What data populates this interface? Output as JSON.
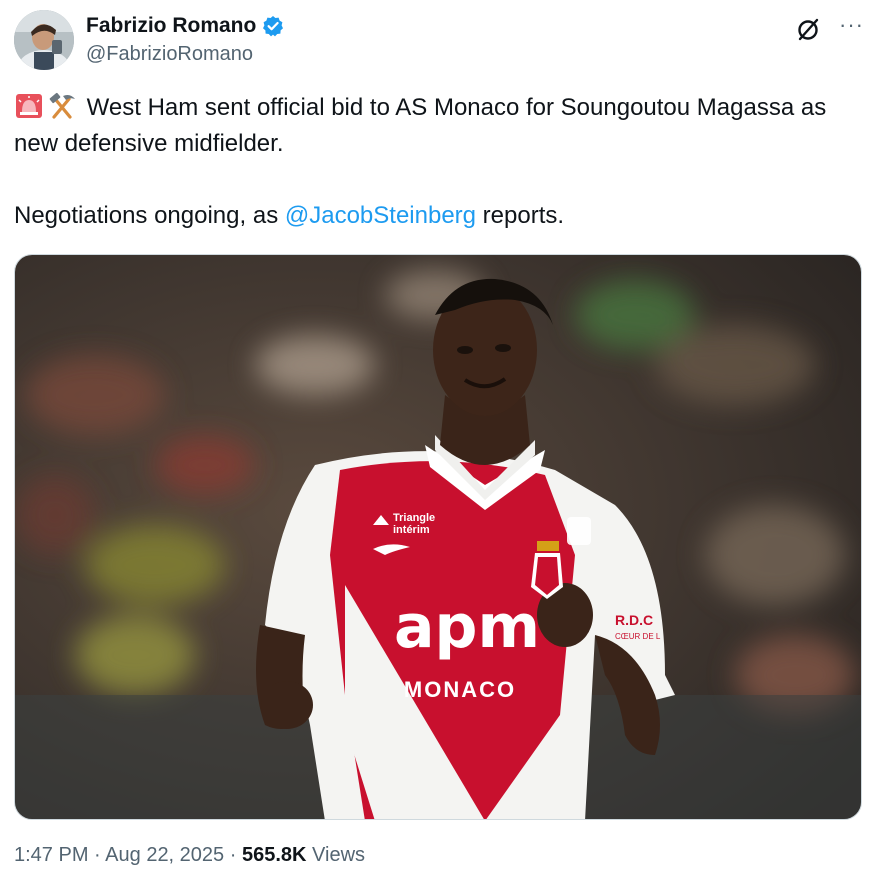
{
  "author": {
    "display_name": "Fabrizio Romano",
    "handle": "@FabrizioRomano",
    "verified": true
  },
  "icons": {
    "verified": "verified-badge-icon",
    "grok": "grok-icon",
    "more": "more-icon",
    "siren": "siren-emoji",
    "hammer_pick": "hammer-and-pick-emoji"
  },
  "tweet": {
    "line1": "West Ham sent official bid to AS Monaco for Soungoutou Magassa as new defensive midfielder.",
    "line2_before": "Negotiations ongoing, as ",
    "line2_mention": "@JacobSteinberg",
    "line2_after": " reports."
  },
  "image": {
    "shirt_sponsor": "apm",
    "shirt_city": "MONACO",
    "sleeve_sponsor": "Triangle intérim",
    "sleeve_badge": "R.D.C.",
    "sleeve_badge_sub": "CŒUR DE L"
  },
  "meta": {
    "time": "1:47 PM",
    "date": "Aug 22, 2025",
    "views_count": "565.8K",
    "views_label": "Views",
    "separator": "·"
  },
  "colors": {
    "link": "#1d9bf0",
    "secondary_text": "#536471",
    "verified": "#1d9bf0",
    "monaco_red": "#c8102e"
  }
}
